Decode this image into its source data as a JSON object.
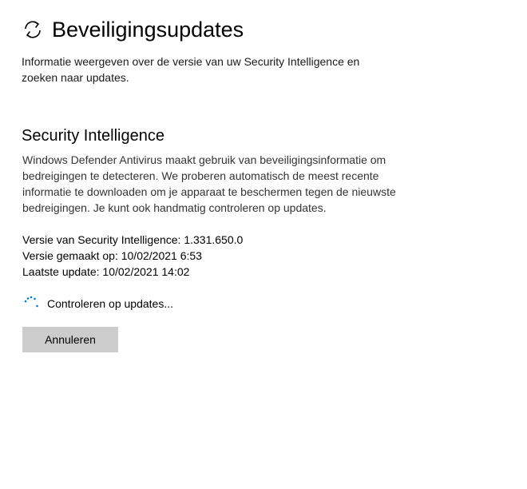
{
  "header": {
    "icon": "refresh-icon",
    "title": "Beveiligingsupdates"
  },
  "description": "Informatie weergeven over de versie van uw Security Intelligence en zoeken naar updates.",
  "section": {
    "title": "Security Intelligence",
    "body": "Windows Defender Antivirus maakt gebruik van beveiligingsinformatie om bedreigingen te detecteren. We proberen automatisch de meest recente informatie te downloaden om je apparaat te beschermen tegen de nieuwste bedreigingen. Je kunt ook handmatig controleren op updates."
  },
  "info": {
    "version": "Versie van Security Intelligence: 1.331.650.0",
    "created": "Versie gemaakt op: 10/02/2021 6:53",
    "last_update": "Laatste update: 10/02/2021 14:02"
  },
  "status": {
    "icon": "loading-spinner-icon",
    "text": "Controleren op updates..."
  },
  "actions": {
    "cancel_label": "Annuleren"
  },
  "colors": {
    "accent": "#0078d7",
    "button_bg": "#cccccc",
    "body_text": "#333333"
  }
}
